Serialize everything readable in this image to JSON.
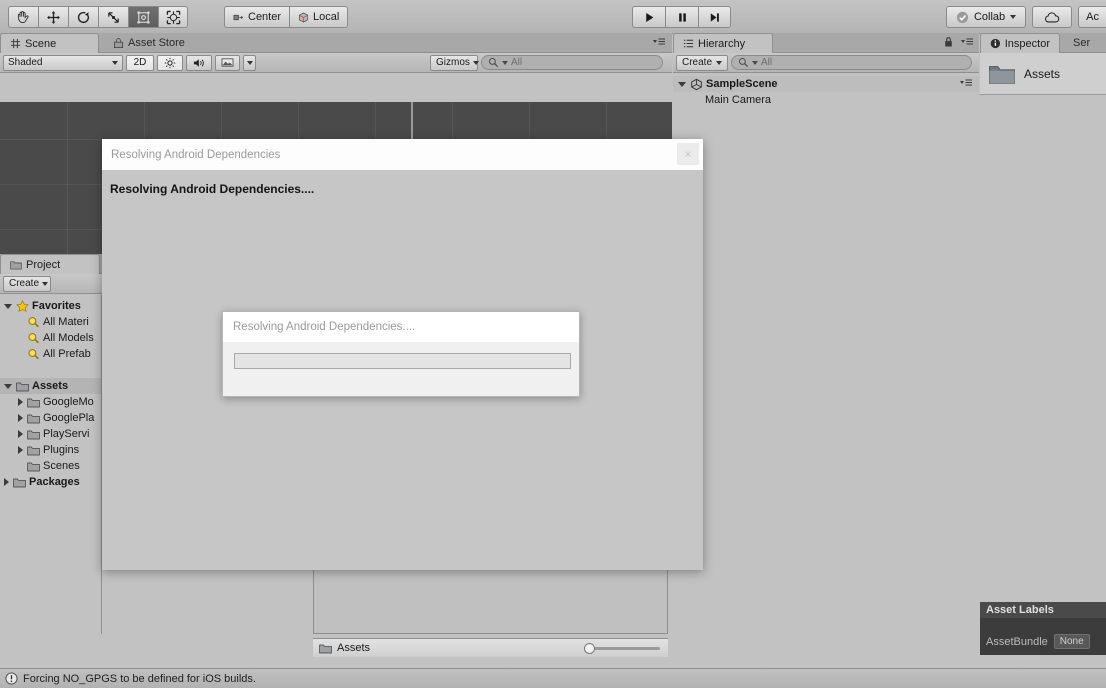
{
  "toolbar": {
    "tools": [
      {
        "name": "hand-tool",
        "glyph": "hand",
        "selected": false
      },
      {
        "name": "move-tool",
        "glyph": "move",
        "selected": false
      },
      {
        "name": "rotate-tool",
        "glyph": "rotate",
        "selected": false
      },
      {
        "name": "scale-tool",
        "glyph": "scale",
        "selected": false
      },
      {
        "name": "rect-tool",
        "glyph": "rect",
        "selected": true
      },
      {
        "name": "transform-tool",
        "glyph": "transform",
        "selected": false
      }
    ],
    "pivot_label": "Center",
    "handle_label": "Local",
    "play_label": "play-icon",
    "pause_label": "pause-icon",
    "step_label": "step-icon",
    "collab_label": "Collab",
    "cloud_label": "cloud-icon",
    "account_label": "Ac"
  },
  "scene_panel": {
    "tabs": [
      {
        "label": "Scene",
        "icon": "grid-icon",
        "active": true
      },
      {
        "label": "Asset Store",
        "icon": "store-icon",
        "active": false
      }
    ],
    "draw_mode": "Shaded",
    "mode_2d": "2D",
    "lighting_icon": "sun-icon",
    "audio_icon": "speaker-icon",
    "effects_icon": "image-icon",
    "gizmos_label": "Gizmos",
    "search_placeholder": "All",
    "menu_icon": "panel-menu-icon"
  },
  "project_panel": {
    "tab_label": "Project",
    "create_label": "Create",
    "tree": [
      {
        "label": "Favorites",
        "depth": 0,
        "arrow": "open",
        "bold": true,
        "icon": "star-icon"
      },
      {
        "label": "All Materi",
        "depth": 1,
        "arrow": "none",
        "bold": false,
        "icon": "search-icon"
      },
      {
        "label": "All Models",
        "depth": 1,
        "arrow": "none",
        "bold": false,
        "icon": "search-icon"
      },
      {
        "label": "All Prefab",
        "depth": 1,
        "arrow": "none",
        "bold": false,
        "icon": "search-icon"
      },
      {
        "label": "",
        "depth": 0,
        "arrow": "none",
        "bold": false,
        "icon": "none"
      },
      {
        "label": "Assets",
        "depth": 0,
        "arrow": "open",
        "bold": true,
        "icon": "folder-icon",
        "selected": true
      },
      {
        "label": "GoogleMo",
        "depth": 1,
        "arrow": "closed",
        "bold": false,
        "icon": "folder-icon"
      },
      {
        "label": "GooglePla",
        "depth": 1,
        "arrow": "closed",
        "bold": false,
        "icon": "folder-icon"
      },
      {
        "label": "PlayServi",
        "depth": 1,
        "arrow": "closed",
        "bold": false,
        "icon": "folder-icon"
      },
      {
        "label": "Plugins",
        "depth": 1,
        "arrow": "closed",
        "bold": false,
        "icon": "folder-icon"
      },
      {
        "label": "Scenes",
        "depth": 1,
        "arrow": "none",
        "bold": false,
        "icon": "folder-icon"
      },
      {
        "label": "Packages",
        "depth": 0,
        "arrow": "closed",
        "bold": true,
        "icon": "folder-icon"
      }
    ],
    "breadcrumb": "Assets",
    "zoom_value": 0
  },
  "hierarchy_panel": {
    "tab_label": "Hierarchy",
    "create_label": "Create",
    "search_placeholder": "All",
    "lock_icon": "lock-icon",
    "menu_icon": "panel-menu-icon",
    "items": [
      {
        "label": "SampleScene",
        "depth": 0,
        "bold": true,
        "arrow": "open",
        "icon": "unity-scene-icon"
      },
      {
        "label": "Main Camera",
        "depth": 1,
        "bold": false,
        "arrow": "none",
        "icon": "none"
      }
    ]
  },
  "inspector_panel": {
    "tabs": [
      {
        "label": "Inspector",
        "active": true,
        "icon": "info-icon"
      },
      {
        "label": "Ser",
        "active": false,
        "icon": "none"
      }
    ],
    "selected_asset": "Assets",
    "asset_icon": "folder-icon",
    "asset_labels_title": "Asset Labels",
    "assetbundle_label": "AssetBundle",
    "assetbundle_value": "None"
  },
  "dialog_outer": {
    "title": "Resolving Android Dependencies",
    "close_label": "×",
    "message": "Resolving Android Dependencies...."
  },
  "dialog_inner": {
    "title": "Resolving Android Dependencies....",
    "progress_percent": 0
  },
  "statusbar": {
    "icon": "warning-icon",
    "message": "Forcing NO_GPGS to be defined for iOS builds."
  },
  "colors": {
    "chrome": "#c2c2c2",
    "tabbar": "#a8a8a8",
    "scene_bg": "#4a4a4a",
    "dialog_bg": "#c6c6c6",
    "dark_panel": "#3c3c3c"
  }
}
